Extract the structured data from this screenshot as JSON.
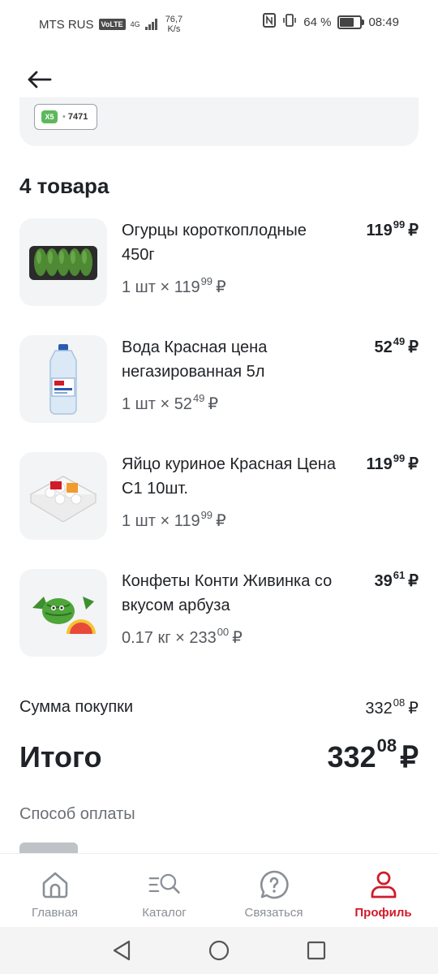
{
  "status_bar": {
    "carrier": "MTS RUS",
    "volte": "VoLTE",
    "network": "4G",
    "speed_value": "76,7",
    "speed_unit": "K/s",
    "battery": "64 %",
    "battery_level": 0.64,
    "time": "08:49"
  },
  "card": {
    "number": "7471",
    "badge": "X5"
  },
  "items_title": "4 товара",
  "items": [
    {
      "name": "Огурцы короткоплодные 450г",
      "price_main": "119",
      "price_kop": "99",
      "currency": "₽",
      "qty": "1 шт ×",
      "unit_main": "119",
      "unit_kop": "99",
      "image": "cucumbers"
    },
    {
      "name": "Вода Красная цена негазированная 5л",
      "price_main": "52",
      "price_kop": "49",
      "currency": "₽",
      "qty": "1 шт ×",
      "unit_main": "52",
      "unit_kop": "49",
      "image": "water-bottle"
    },
    {
      "name": "Яйцо куриное Красная Цена С1 10шт.",
      "price_main": "119",
      "price_kop": "99",
      "currency": "₽",
      "qty": "1 шт ×",
      "unit_main": "119",
      "unit_kop": "99",
      "image": "egg-tray"
    },
    {
      "name": "Конфеты Конти Живинка со вкусом арбуза",
      "price_main": "39",
      "price_kop": "61",
      "currency": "₽",
      "qty": "0.17 кг ×",
      "unit_main": "233",
      "unit_kop": "00",
      "image": "watermelon-candy"
    }
  ],
  "summary": {
    "sum_label": "Сумма покупки",
    "sum_main": "332",
    "sum_kop": "08",
    "total_label": "Итого",
    "total_main": "332",
    "total_kop": "08",
    "currency": "₽"
  },
  "payment_label": "Способ оплаты",
  "bottom_nav": [
    {
      "label": "Главная",
      "icon": "home-icon",
      "active": false
    },
    {
      "label": "Каталог",
      "icon": "catalog-search-icon",
      "active": false
    },
    {
      "label": "Связаться",
      "icon": "question-bubble-icon",
      "active": false
    },
    {
      "label": "Профиль",
      "icon": "profile-icon",
      "active": true
    }
  ],
  "colors": {
    "accent": "#d11a2a",
    "text": "#1f2226",
    "muted": "#8a8f96",
    "card_bg": "#f3f4f6"
  }
}
